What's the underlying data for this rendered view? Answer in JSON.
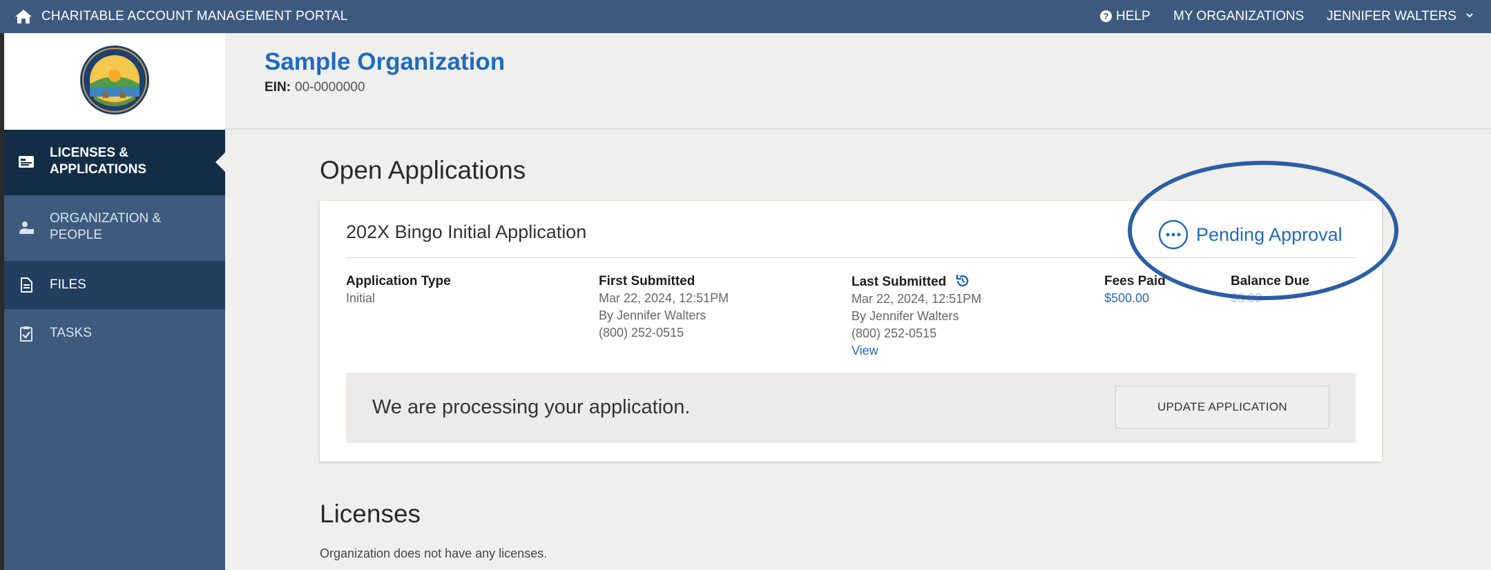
{
  "topbar": {
    "portal_title": "CHARITABLE ACCOUNT MANAGEMENT PORTAL",
    "help": "HELP",
    "my_organizations": "MY ORGANIZATIONS",
    "user_name": "JENNIFER WALTERS",
    "icons": [
      "home-icon",
      "help-icon",
      "chevron-down-icon"
    ]
  },
  "sidebar": {
    "items": [
      {
        "line1": "LICENSES &",
        "line2": "APPLICATIONS",
        "icon": "license-card-icon",
        "active": true
      },
      {
        "line1": "ORGANIZATION &",
        "line2": "PEOPLE",
        "icon": "people-icon",
        "active": false
      },
      {
        "line1": "FILES",
        "line2": "",
        "icon": "file-icon",
        "active": false
      },
      {
        "line1": "TASKS",
        "line2": "",
        "icon": "clipboard-check-icon",
        "active": false
      }
    ]
  },
  "organization": {
    "name": "Sample Organization",
    "ein_label": "EIN:",
    "ein_value": "00-0000000"
  },
  "open_applications": {
    "heading": "Open Applications",
    "application": {
      "title_year": "202X",
      "title_rest": " Bingo Initial Application",
      "status": "Pending Approval",
      "columns": {
        "type": {
          "header": "Application Type",
          "value": "Initial"
        },
        "first_submitted": {
          "header": "First Submitted",
          "date": "Mar 22, 2024, 12:51PM",
          "by": "By Jennifer Walters",
          "phone": "(800) 252-0515"
        },
        "last_submitted": {
          "header": "Last Submitted",
          "date": "Mar 22, 2024, 12:51PM",
          "by": "By Jennifer Walters",
          "phone": "(800) 252-0515",
          "view": "View"
        },
        "fees_paid": {
          "header": "Fees Paid",
          "value": "$500.00"
        },
        "balance_due": {
          "header": "Balance Due",
          "value": "$0.00"
        }
      },
      "processing_message": "We are processing your application.",
      "update_button": "UPDATE APPLICATION"
    }
  },
  "licenses": {
    "heading": "Licenses",
    "empty_message": "Organization does not have any licenses."
  },
  "colors": {
    "topbar": "#3d5a7e",
    "sidebar": "#3e5a7d",
    "sidebar_active": "#132d46",
    "accent_blue": "#1f6bbf",
    "highlight_ellipse": "#2b5ea6"
  }
}
